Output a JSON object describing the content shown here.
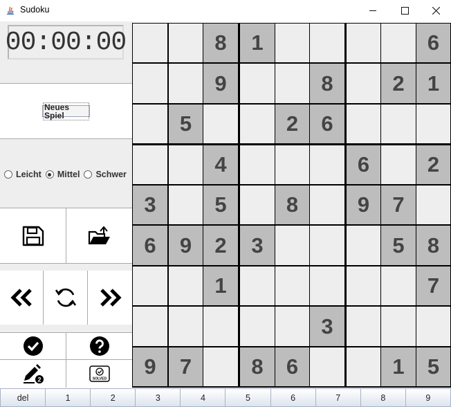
{
  "window": {
    "title": "Sudoku",
    "controls": [
      "minimize-icon",
      "maximize-icon",
      "close-icon"
    ]
  },
  "timer": "00:00:00",
  "new_game_label": "Neues Spiel",
  "difficulty": {
    "options": [
      "Leicht",
      "Mittel",
      "Schwer"
    ],
    "selected": "Mittel"
  },
  "toolbar": {
    "save_icon": "save-icon",
    "load_icon": "open-folder-icon",
    "undo_icon": "double-left-icon",
    "refresh_icon": "refresh-icon",
    "redo_icon": "double-right-icon",
    "check_icon": "check-circle-icon",
    "help_icon": "question-circle-icon",
    "notes_icon": "pencil-notes-icon",
    "solved_icon": "solved-badge-icon",
    "solved_label": "SOLVED"
  },
  "board": {
    "rows": [
      [
        "",
        "",
        "8",
        "1",
        "",
        "",
        "",
        "",
        "6"
      ],
      [
        "",
        "",
        "9",
        "",
        "",
        "8",
        "",
        "2",
        "1"
      ],
      [
        "",
        "5",
        "",
        "",
        "2",
        "6",
        "",
        "",
        ""
      ],
      [
        "",
        "",
        "4",
        "",
        "",
        "",
        "6",
        "",
        "2"
      ],
      [
        "3",
        "",
        "5",
        "",
        "8",
        "",
        "9",
        "7",
        ""
      ],
      [
        "6",
        "9",
        "2",
        "3",
        "",
        "",
        "",
        "5",
        "8"
      ],
      [
        "",
        "",
        "1",
        "",
        "",
        "",
        "",
        "",
        "7"
      ],
      [
        "",
        "",
        "",
        "",
        "",
        "3",
        "",
        "",
        ""
      ],
      [
        "9",
        "7",
        "",
        "8",
        "6",
        "",
        "",
        "1",
        "5"
      ]
    ]
  },
  "number_bar": [
    "del",
    "1",
    "2",
    "3",
    "4",
    "5",
    "6",
    "7",
    "8",
    "9"
  ],
  "colors": {
    "given_cell": "#bdbdbd",
    "empty_cell": "#eeeeee",
    "grid_line": "#000000",
    "panel_bg": "#eeeeee"
  }
}
